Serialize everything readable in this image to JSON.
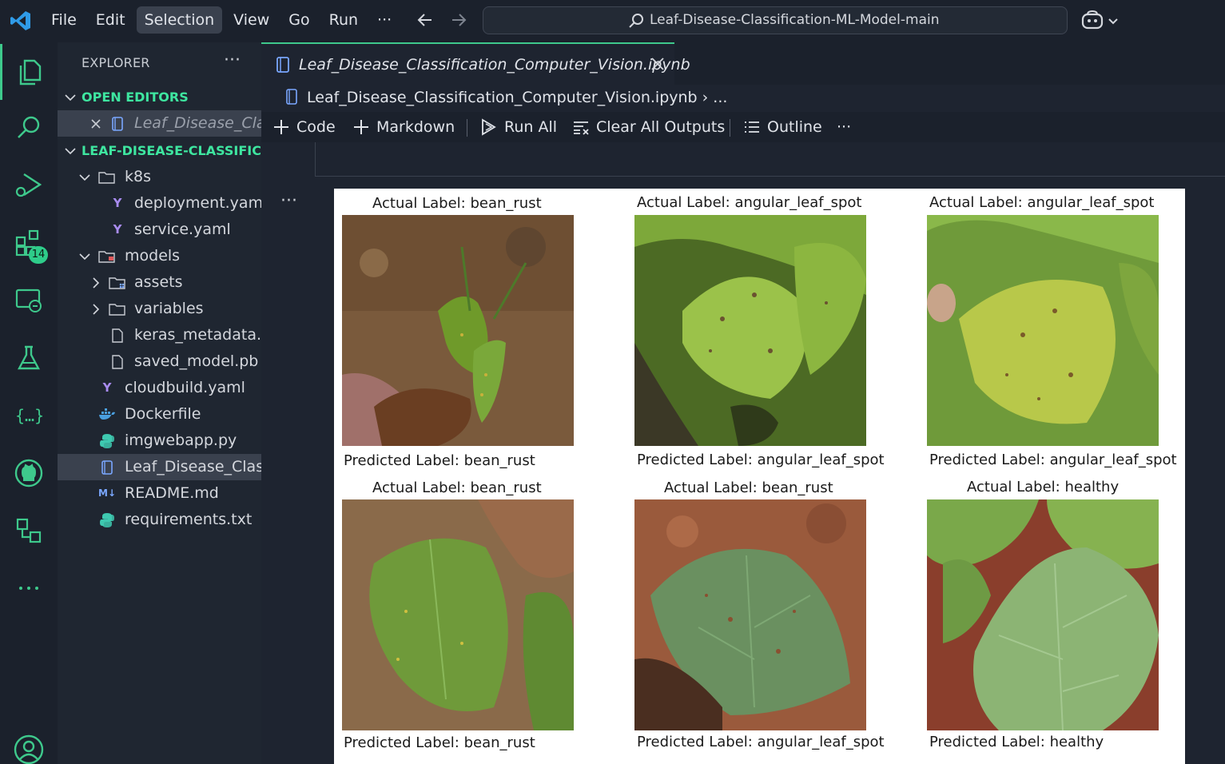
{
  "menu": {
    "items": [
      "File",
      "Edit",
      "Selection",
      "View",
      "Go",
      "Run",
      "···"
    ],
    "active": "Selection"
  },
  "search": {
    "text": "Leaf-Disease-Classification-ML-Model-main"
  },
  "activity": {
    "extensions_badge": "14"
  },
  "explorer": {
    "title": "EXPLORER",
    "more": "···",
    "open_editors_label": "OPEN EDITORS",
    "open_editor_file": "Leaf_Disease_Cla...",
    "project_label": "LEAF-DISEASE-CLASSIFICA...",
    "tree": [
      {
        "label": "k8s",
        "kind": "folder-open"
      },
      {
        "label": "deployment.yaml",
        "kind": "yaml"
      },
      {
        "label": "service.yaml",
        "kind": "yaml"
      },
      {
        "label": "models",
        "kind": "folder-open-red"
      },
      {
        "label": "assets",
        "kind": "folder-closed"
      },
      {
        "label": "variables",
        "kind": "folder-closed"
      },
      {
        "label": "keras_metadata....",
        "kind": "file"
      },
      {
        "label": "saved_model.pb",
        "kind": "file"
      },
      {
        "label": "cloudbuild.yaml",
        "kind": "yaml"
      },
      {
        "label": "Dockerfile",
        "kind": "docker"
      },
      {
        "label": "imgwebapp.py",
        "kind": "python"
      },
      {
        "label": "Leaf_Disease_Clas...",
        "kind": "notebook"
      },
      {
        "label": "README.md",
        "kind": "markdown"
      },
      {
        "label": "requirements.txt",
        "kind": "python"
      }
    ]
  },
  "editor": {
    "tab_title": "Leaf_Disease_Classification_Computer_Vision.ipynb",
    "breadcrumb": "Leaf_Disease_Classification_Computer_Vision.ipynb › ...",
    "toolbar": {
      "code": "Code",
      "markdown": "Markdown",
      "run_all": "Run All",
      "clear_outputs": "Clear All Outputs",
      "outline": "Outline",
      "more": "···"
    },
    "cell_more": "···"
  },
  "figure": {
    "panels": [
      {
        "actual": "Actual Label: bean_rust",
        "predicted": "Predicted Label: bean_rust"
      },
      {
        "actual": "Actual Label: angular_leaf_spot",
        "predicted": "Predicted Label: angular_leaf_spot"
      },
      {
        "actual": "Actual Label: angular_leaf_spot",
        "predicted": "Predicted Label: angular_leaf_spot"
      },
      {
        "actual": "Actual Label: bean_rust",
        "predicted": "Predicted Label: bean_rust"
      },
      {
        "actual": "Actual Label: bean_rust",
        "predicted": "Predicted Label: angular_leaf_spot"
      },
      {
        "actual": "Actual Label: healthy",
        "predicted": "Predicted Label: healthy"
      }
    ]
  },
  "colors": {
    "accent": "#3ec98c",
    "section_text": "#3ee6a0",
    "background": "#1e2430",
    "sidebar": "#1f2631"
  }
}
